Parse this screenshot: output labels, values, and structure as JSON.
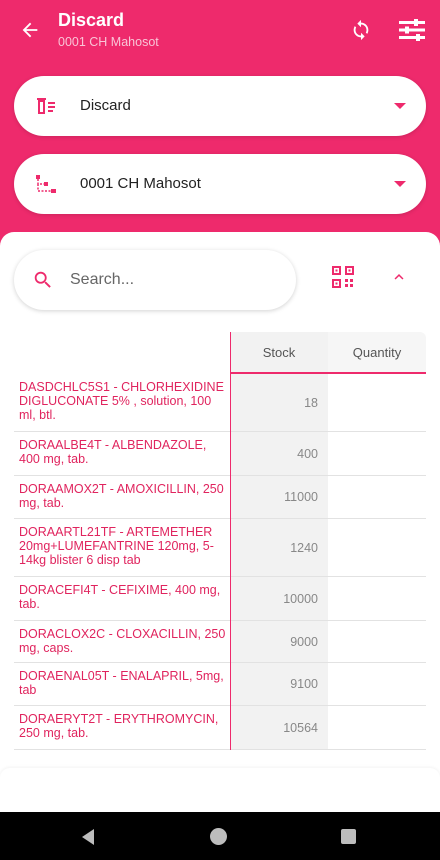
{
  "header": {
    "title": "Discard",
    "subtitle": "0001 CH Mahosot",
    "accent_color": "#ee2a6c"
  },
  "selectors": [
    {
      "label": "Discard",
      "icon": "discard-list-icon"
    },
    {
      "label": "0001 CH Mahosot",
      "icon": "hierarchy-icon"
    }
  ],
  "search": {
    "placeholder": "Search..."
  },
  "table": {
    "columns": [
      "Stock",
      "Quantity"
    ],
    "rows": [
      {
        "name": "DASDCHLC5S1 - CHLORHEXIDINE DIGLUCONATE 5% , solution, 100 ml, btl.",
        "stock": "18",
        "quantity": ""
      },
      {
        "name": "DORAALBE4T - ALBENDAZOLE, 400 mg, tab.",
        "stock": "400",
        "quantity": ""
      },
      {
        "name": "DORAAMOX2T - AMOXICILLIN, 250 mg, tab.",
        "stock": "11000",
        "quantity": ""
      },
      {
        "name": "DORAARTL21TF - ARTEMETHER 20mg+LUMEFANTRINE 120mg, 5-14kg blister 6 disp tab",
        "stock": "1240",
        "quantity": ""
      },
      {
        "name": "DORACEFI4T - CEFIXIME, 400 mg, tab.",
        "stock": "10000",
        "quantity": ""
      },
      {
        "name": "DORACLOX2C - CLOXACILLIN, 250 mg, caps.",
        "stock": "9000",
        "quantity": ""
      },
      {
        "name": "DORAENAL05T - ENALAPRIL, 5mg, tab",
        "stock": "9100",
        "quantity": ""
      },
      {
        "name": "DORAERYT2T - ERYTHROMYCIN, 250 mg, tab.",
        "stock": "10564",
        "quantity": ""
      }
    ]
  }
}
